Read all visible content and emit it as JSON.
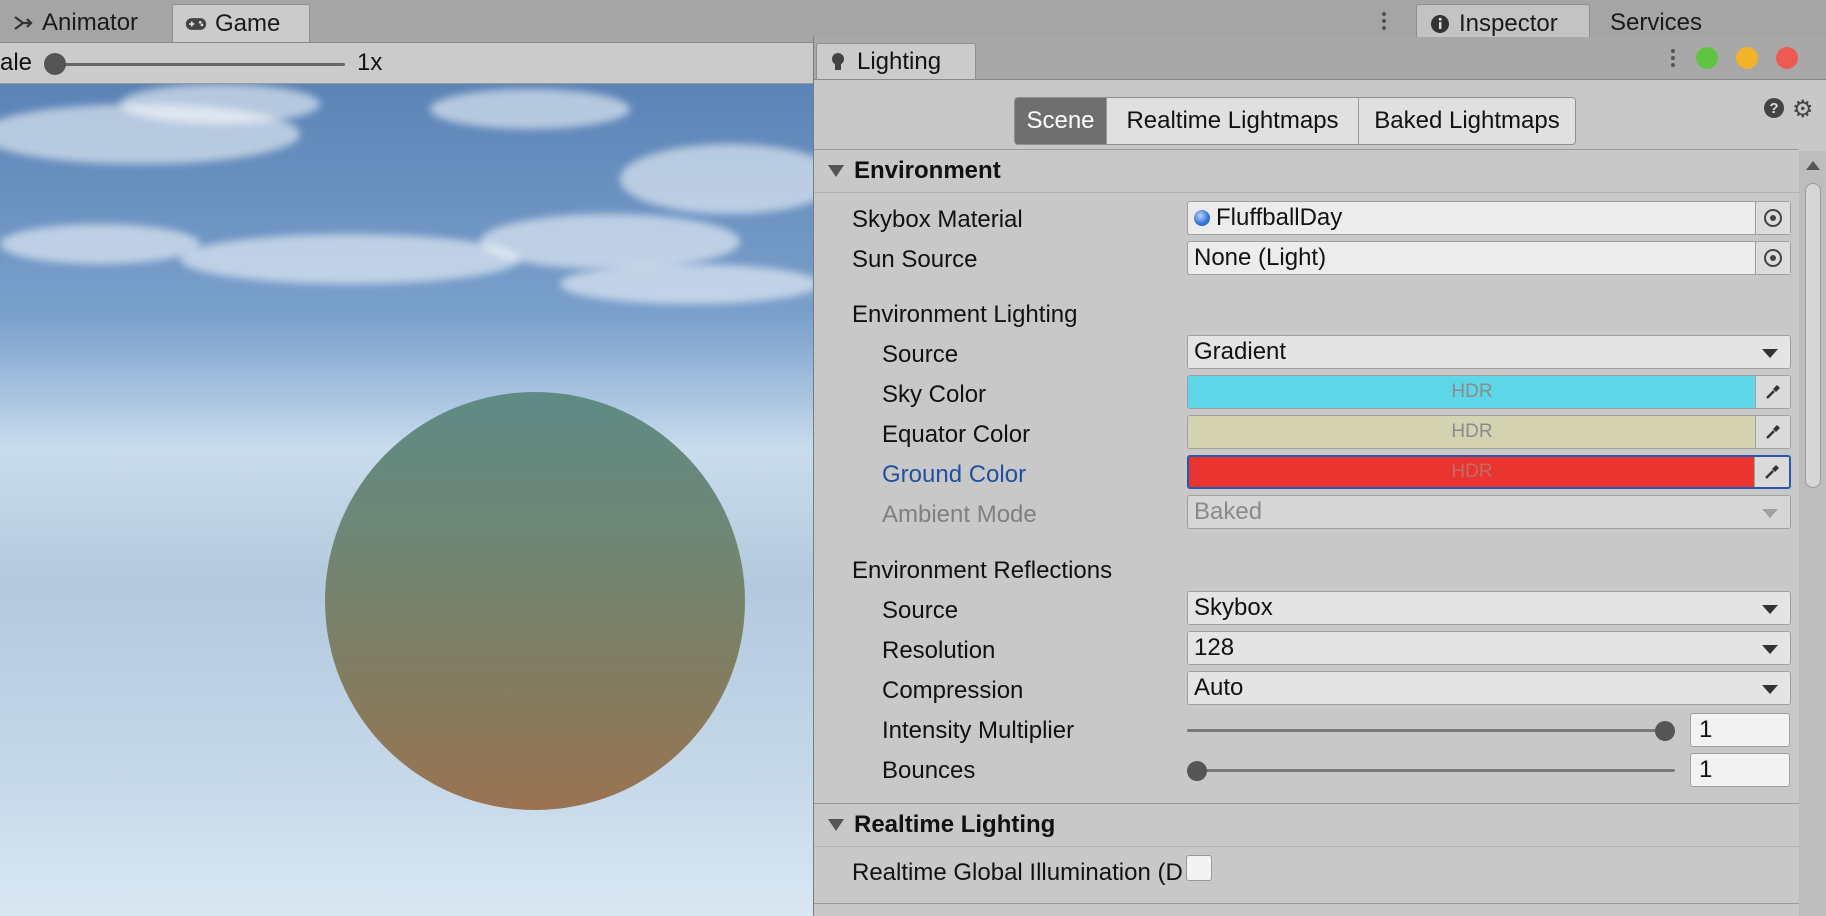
{
  "top_tabs": {
    "animator": "Animator",
    "game": "Game",
    "inspector": "Inspector",
    "services": "Services"
  },
  "game_toolbar": {
    "scale_label": "ale",
    "scale_value": "1x",
    "scale_level": 0.0
  },
  "lighting": {
    "window_title": "Lighting",
    "tabs": [
      "Scene",
      "Realtime Lightmaps",
      "Baked Lightmaps"
    ],
    "active_tab": "Scene",
    "window_buttons": {
      "green": "#5ec442",
      "yellow": "#f1b428",
      "red": "#ec5a51"
    },
    "environment": {
      "header": "Environment",
      "skybox_material": {
        "label": "Skybox Material",
        "value": "FluffballDay"
      },
      "sun_source": {
        "label": "Sun Source",
        "value": "None (Light)"
      },
      "env_lighting": {
        "header": "Environment Lighting",
        "source": {
          "label": "Source",
          "value": "Gradient"
        },
        "sky_color": {
          "label": "Sky Color",
          "hdr": "HDR",
          "color": "#5dd6e7"
        },
        "equator_color": {
          "label": "Equator Color",
          "hdr": "HDR",
          "color": "#d3d3b2"
        },
        "ground_color": {
          "label": "Ground Color",
          "hdr": "HDR",
          "color": "#ea3430"
        },
        "ambient_mode": {
          "label": "Ambient Mode",
          "value": "Baked"
        }
      },
      "env_reflections": {
        "header": "Environment Reflections",
        "source": {
          "label": "Source",
          "value": "Skybox"
        },
        "resolution": {
          "label": "Resolution",
          "value": "128"
        },
        "compression": {
          "label": "Compression",
          "value": "Auto"
        },
        "intensity_multiplier": {
          "label": "Intensity Multiplier",
          "value": "1",
          "level": 1.0
        },
        "bounces": {
          "label": "Bounces",
          "value": "1",
          "level": 0.0
        }
      }
    },
    "realtime_lighting": {
      "header": "Realtime Lighting",
      "realtime_gi": {
        "label": "Realtime Global Illumination (D",
        "checked": false
      }
    }
  }
}
